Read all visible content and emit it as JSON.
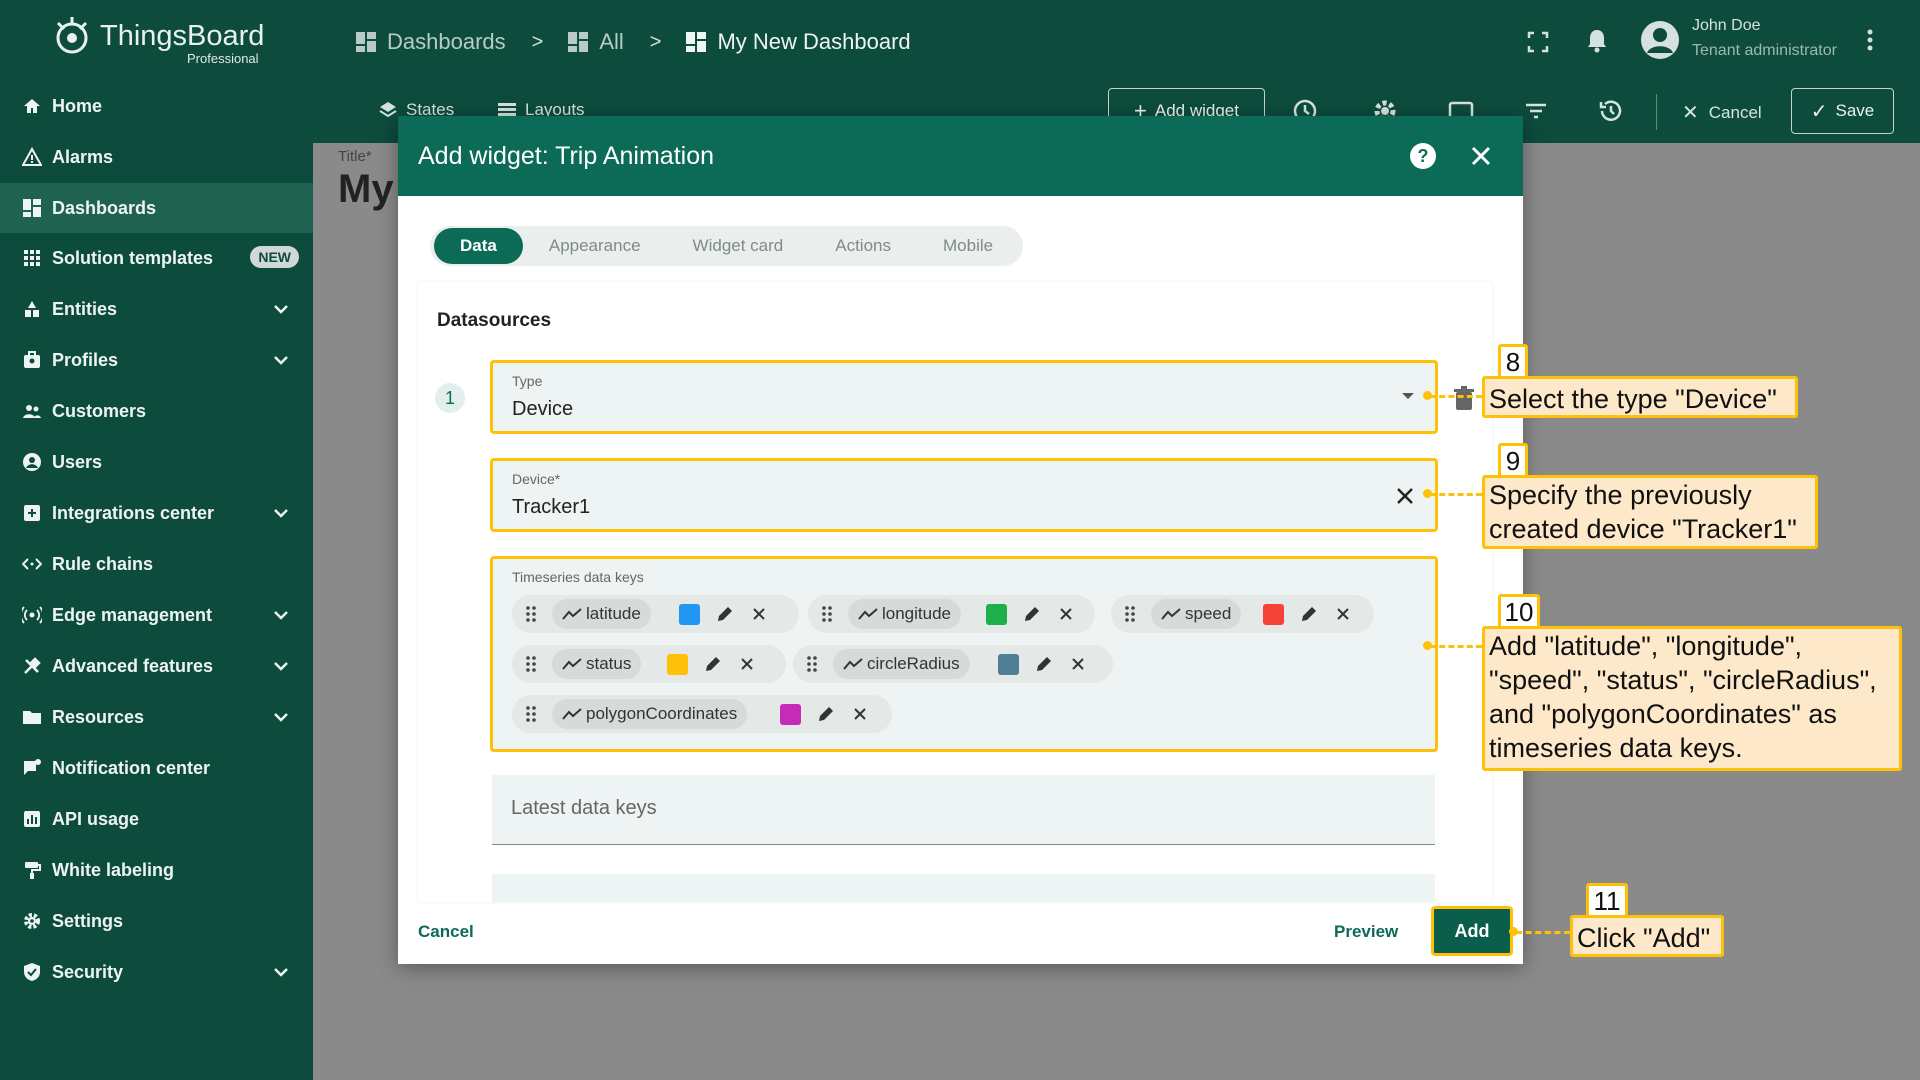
{
  "app": {
    "name": "ThingsBoard",
    "edition": "Professional"
  },
  "breadcrumbs": [
    "Dashboards",
    "All",
    "My New Dashboard"
  ],
  "breadcrumb_separator": ">",
  "user": {
    "name": "John Doe",
    "role": "Tenant administrator"
  },
  "sidebar": {
    "items": [
      {
        "label": "Home",
        "icon": "home-icon"
      },
      {
        "label": "Alarms",
        "icon": "alarm-icon"
      },
      {
        "label": "Dashboards",
        "icon": "dashboard-icon",
        "active": true
      },
      {
        "label": "Solution templates",
        "icon": "grid-icon",
        "badge": "NEW"
      },
      {
        "label": "Entities",
        "icon": "entities-icon",
        "expandable": true
      },
      {
        "label": "Profiles",
        "icon": "profiles-icon",
        "expandable": true
      },
      {
        "label": "Customers",
        "icon": "customers-icon"
      },
      {
        "label": "Users",
        "icon": "user-icon"
      },
      {
        "label": "Integrations center",
        "icon": "integrations-icon",
        "expandable": true
      },
      {
        "label": "Rule chains",
        "icon": "rule-chains-icon"
      },
      {
        "label": "Edge management",
        "icon": "edge-icon",
        "expandable": true
      },
      {
        "label": "Advanced features",
        "icon": "tools-icon",
        "expandable": true
      },
      {
        "label": "Resources",
        "icon": "folder-icon",
        "expandable": true
      },
      {
        "label": "Notification center",
        "icon": "notification-icon"
      },
      {
        "label": "API usage",
        "icon": "api-usage-icon"
      },
      {
        "label": "White labeling",
        "icon": "paint-roller-icon"
      },
      {
        "label": "Settings",
        "icon": "gear-icon"
      },
      {
        "label": "Security",
        "icon": "shield-icon",
        "expandable": true
      }
    ]
  },
  "dashboard_toolbar": {
    "states": "States",
    "layouts": "Layouts",
    "add_widget": "Add widget",
    "cancel": "Cancel",
    "save": "Save"
  },
  "dashboard": {
    "title_label": "Title*",
    "title_value": "My"
  },
  "dialog": {
    "title": "Add widget:  Trip Animation",
    "tabs": [
      "Data",
      "Appearance",
      "Widget card",
      "Actions",
      "Mobile"
    ],
    "active_tab": "Data",
    "datasources_title": "Datasources",
    "datasource_index": "1",
    "type_field": {
      "label": "Type",
      "value": "Device"
    },
    "device_field": {
      "label": "Device*",
      "value": "Tracker1"
    },
    "timeseries_label": "Timeseries data keys",
    "keys": [
      {
        "name": "latitude",
        "color": "#2196f3"
      },
      {
        "name": "longitude",
        "color": "#1db04a"
      },
      {
        "name": "speed",
        "color": "#f44336"
      },
      {
        "name": "status",
        "color": "#ffc107"
      },
      {
        "name": "circleRadius",
        "color": "#4f7f94"
      },
      {
        "name": "polygonCoordinates",
        "color": "#c62ab8"
      }
    ],
    "latest_label": "Latest data keys",
    "cancel": "Cancel",
    "preview": "Preview",
    "add": "Add"
  },
  "callouts": [
    {
      "step": "8",
      "text": "Select the type \"Device\""
    },
    {
      "step": "9",
      "text": "Specify the previously created device \"Tracker1\""
    },
    {
      "step": "10",
      "text": "Add \"latitude\", \"longitude\", \"speed\", \"status\", \"circleRadius\", and \"polygonCoordinates\" as timeseries data keys."
    },
    {
      "step": "11",
      "text": "Click \"Add\""
    }
  ],
  "colors": {
    "primary": "#0d4c3d",
    "accent": "#0c6b57",
    "highlight": "#ffc107",
    "callout_bg": "#fde8c9"
  }
}
